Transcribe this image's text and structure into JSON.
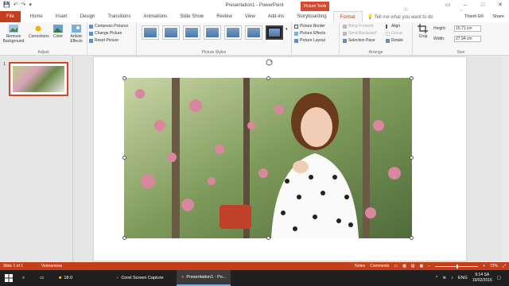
{
  "window": {
    "title": "Presentation1 - PowerPoint",
    "context_tab": "Picture Tools",
    "user": "Thành Đỗ",
    "share": "Share"
  },
  "tabs": [
    "File",
    "Home",
    "Insert",
    "Design",
    "Transitions",
    "Animations",
    "Slide Show",
    "Review",
    "View",
    "Add-ins",
    "Storyboarding",
    "Format"
  ],
  "active_tab": "Format",
  "tellme": "Tell me what you want to do",
  "ribbon": {
    "adjust": {
      "remove_background": "Remove Background",
      "corrections": "Corrections",
      "color": "Color",
      "artistic": "Artistic Effects",
      "compress": "Compress Pictures",
      "change": "Change Picture",
      "reset": "Reset Picture",
      "label": "Adjust"
    },
    "styles": {
      "label": "Picture Styles",
      "border": "Picture Border",
      "effects": "Picture Effects",
      "layout": "Picture Layout"
    },
    "arrange": {
      "label": "Arrange",
      "bring_forward": "Bring Forward",
      "send_backward": "Send Backward",
      "selection_pane": "Selection Pane",
      "align": "Align",
      "group": "Group",
      "rotate": "Rotate"
    },
    "size": {
      "label": "Size",
      "crop": "Crop",
      "height_label": "Height:",
      "height": "15,71 cm",
      "width_label": "Width:",
      "width": "27,94 cm"
    }
  },
  "slides": {
    "number": "1"
  },
  "statusbar": {
    "slide": "Slide 1 of 1",
    "language": "Vietnamese",
    "notes": "Notes",
    "comments": "Comments",
    "zoom": "72%"
  },
  "taskbar": {
    "folder": "18.0",
    "app1": "Corel Screen Capture",
    "app2": "Presentation1 - Po...",
    "lang": "ENG",
    "time": "9:14 SA",
    "date": "19/02/2016"
  },
  "colors": {
    "accent": "#c43e1c",
    "taskbar": "#1f1f1f"
  }
}
